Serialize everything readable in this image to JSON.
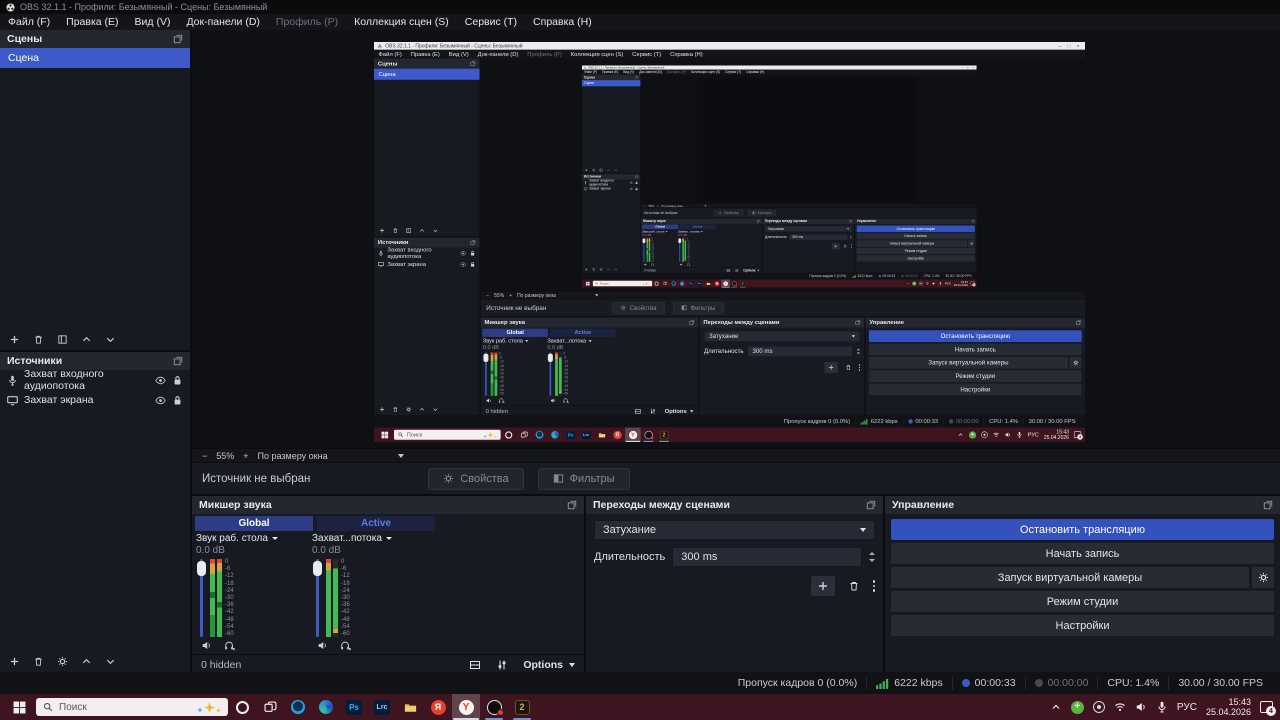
{
  "window": {
    "title": "OBS 32.1.1 - Профили: Безымянный - Сцены: Безымянный",
    "minimize": "–",
    "maximize": "□",
    "close": "×"
  },
  "menu": {
    "items": [
      "Файл (F)",
      "Правка (E)",
      "Вид (V)",
      "Док-панели (D)",
      "Профиль (P)",
      "Коллекция сцен (S)",
      "Сервис (T)",
      "Справка (H)"
    ]
  },
  "scenes": {
    "title": "Сцены",
    "scene": "Сцена"
  },
  "sources": {
    "title": "Источники",
    "item1": "Захват входного аудиопотока",
    "item2": "Захват экрана"
  },
  "preview_bar": {
    "zoom_out": "−",
    "zoom": "55%",
    "zoom_in": "+",
    "fit": "По размеру окна"
  },
  "context": {
    "status": "Источник не выбран",
    "properties": "Свойства",
    "filters": "Фильтры"
  },
  "mixer": {
    "title": "Микшер звука",
    "tabs": [
      "Global",
      "Active"
    ],
    "channels": [
      {
        "name": "Звук раб. стола",
        "level": "0.0 dB"
      },
      {
        "name": "Захват...потока",
        "level": "0.0 dB"
      }
    ],
    "ticks": [
      "0",
      "-6",
      "-12",
      "-18",
      "-24",
      "-30",
      "-36",
      "-42",
      "-48",
      "-54",
      "-60"
    ],
    "hidden_label": "0 hidden",
    "options_label": "Options"
  },
  "transitions": {
    "title": "Переходы между сценами",
    "type": "Затухание",
    "duration_label": "Длительность",
    "duration": "300 ms"
  },
  "controls": {
    "title": "Управление",
    "stop_stream": "Остановить трансляцию",
    "start_record": "Начать запись",
    "virtual_cam": "Запуск виртуальной камеры",
    "studio_mode": "Режим студии",
    "settings": "Настройки"
  },
  "statusbar": {
    "dropped": "Пропуск кадров 0 (0.0%)",
    "bitrate": "6222 kbps",
    "stream_time": "00:00:33",
    "rec_time": "00:00:00",
    "cpu": "CPU: 1.4%",
    "fps": "30.00 / 30.00 FPS"
  },
  "taskbar": {
    "search": "Поиск",
    "ps": "Ps",
    "lrc": "Lrc",
    "yandex": "Я",
    "ybrowser": "Y",
    "app2": "2",
    "lang": "РУС",
    "time": "15:43",
    "date": "25.04.2026",
    "badge": "4"
  },
  "colors": {
    "accent": "#3e59c9",
    "stream_active": "#3451be",
    "taskbar_bg": "#3d141f",
    "meter_green": "#3fba54",
    "meter_yellow": "#d9a13c",
    "meter_red": "#e0443a"
  }
}
